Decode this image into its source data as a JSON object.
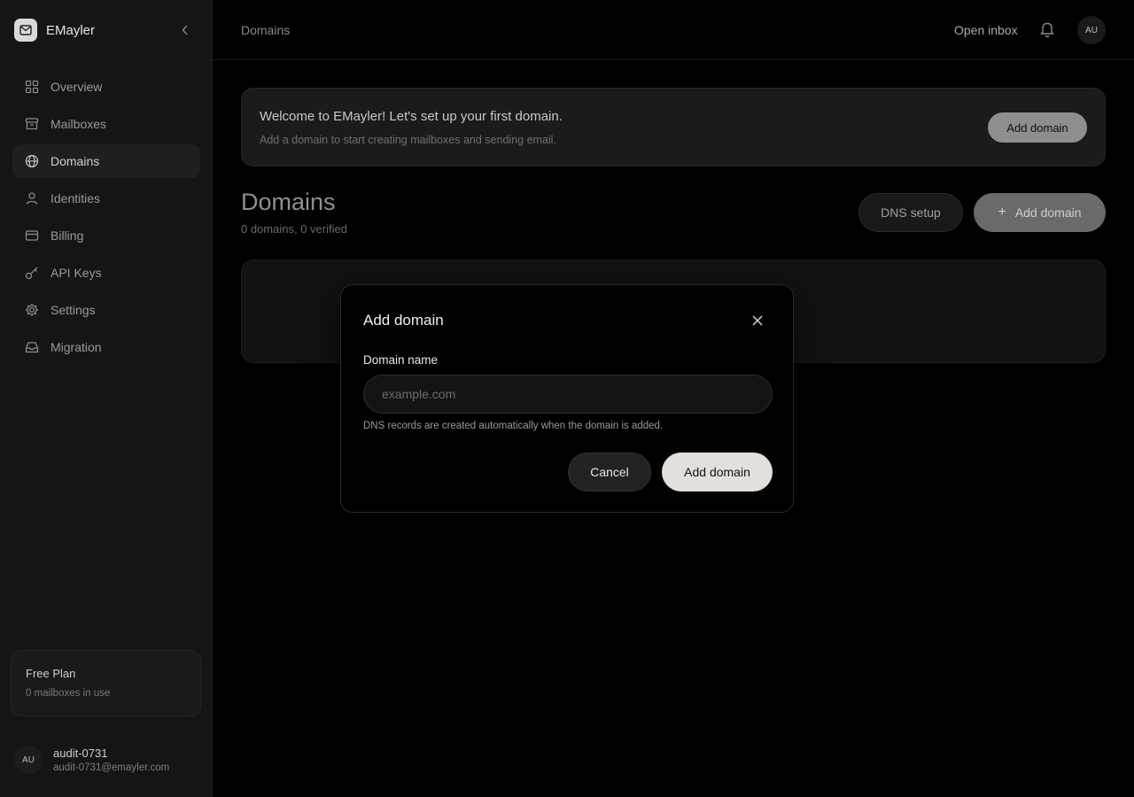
{
  "app": {
    "name": "EMayler"
  },
  "sidebar": {
    "items": [
      {
        "label": "Overview",
        "icon": "grid-icon"
      },
      {
        "label": "Mailboxes",
        "icon": "archive-icon"
      },
      {
        "label": "Domains",
        "icon": "globe-icon",
        "active": true
      },
      {
        "label": "Identities",
        "icon": "user-icon"
      },
      {
        "label": "Billing",
        "icon": "credit-card-icon"
      },
      {
        "label": "API Keys",
        "icon": "key-icon"
      },
      {
        "label": "Settings",
        "icon": "gear-icon"
      },
      {
        "label": "Migration",
        "icon": "inbox-icon"
      }
    ],
    "plan": {
      "title": "Free Plan",
      "usage": "0 mailboxes in use"
    },
    "user": {
      "initials": "AU",
      "name": "audit-0731",
      "email": "audit-0731@emayler.com"
    }
  },
  "topbar": {
    "breadcrumb": "Domains",
    "open_inbox": "Open inbox",
    "avatar_initials": "AU"
  },
  "welcome": {
    "title": "Welcome to EMayler! Let's set up your first domain.",
    "subtitle": "Add a domain to start creating mailboxes and sending email.",
    "button": "Add domain"
  },
  "page": {
    "title": "Domains",
    "summary": "0 domains, 0 verified",
    "dns_button": "DNS setup",
    "add_button": "Add domain"
  },
  "modal": {
    "title": "Add domain",
    "field_label": "Domain name",
    "field_placeholder": "example.com",
    "field_value": "",
    "help": "DNS records are created automatically when the domain is added.",
    "cancel": "Cancel",
    "confirm": "Add domain"
  },
  "colors": {
    "background": "#000000",
    "sidebar": "#151515",
    "primary_button": "#e3dfdc"
  }
}
